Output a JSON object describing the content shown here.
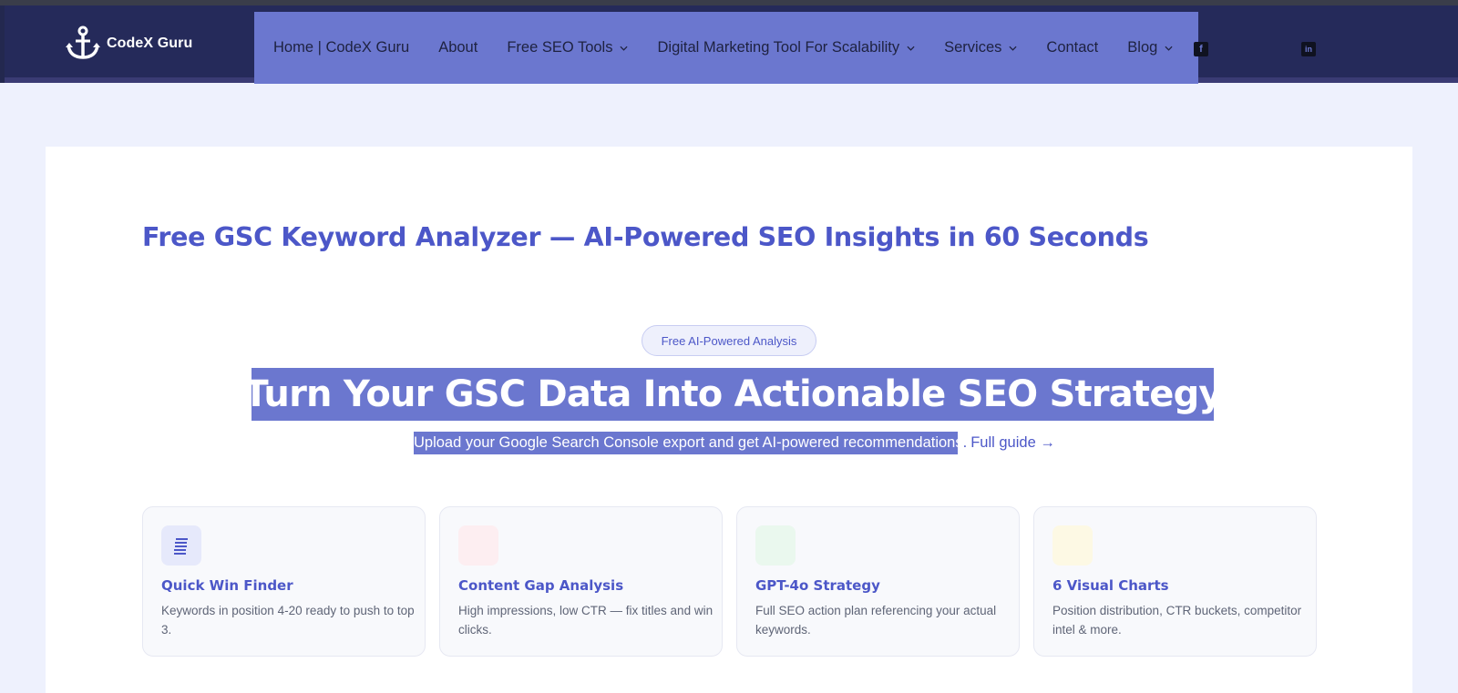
{
  "header": {
    "logo_text": "CodeX Guru",
    "nav": [
      {
        "label": "Home | CodeX Guru",
        "dropdown": false
      },
      {
        "label": "About",
        "dropdown": false
      },
      {
        "label": "Free SEO Tools",
        "dropdown": true
      },
      {
        "label": "Digital Marketing Tool For Scalability",
        "dropdown": true
      },
      {
        "label": "Services",
        "dropdown": true
      },
      {
        "label": "Contact",
        "dropdown": false
      },
      {
        "label": "Blog",
        "dropdown": true
      }
    ],
    "social": [
      {
        "icon": "facebook-icon",
        "glyph": "f"
      },
      {
        "icon": "linkedin-icon",
        "glyph": "in"
      }
    ]
  },
  "page": {
    "title": "Free GSC Keyword Analyzer — AI-Powered SEO Insights in 60 Seconds",
    "badge": "Free AI-Powered Analysis",
    "hero": "Turn Your GSC Data Into Actionable SEO Strategy",
    "subtitle": "Upload your Google Search Console export and get AI-powered recommendations",
    "subtitle_dot": ".",
    "guide_link": "Full guide →"
  },
  "features": [
    {
      "title": "Quick Win Finder",
      "desc": "Keywords in position 4-20 ready to push to top 3.",
      "icon": "document-icon",
      "icon_bg": "#e6e9fb"
    },
    {
      "title": "Content Gap Analysis",
      "desc": "High impressions, low CTR — fix titles and win clicks.",
      "icon": "gap-icon",
      "icon_bg": "#fdeef1"
    },
    {
      "title": "GPT-4o Strategy",
      "desc": "Full SEO action plan referencing your actual keywords.",
      "icon": "strategy-icon",
      "icon_bg": "#eaf8ee"
    },
    {
      "title": "6 Visual Charts",
      "desc": "Position distribution, CTR buckets, competitor intel & more.",
      "icon": "chart-icon",
      "icon_bg": "#fdf9e4"
    }
  ],
  "colors": {
    "accent": "#4c57c8",
    "nav_bg": "#6b77cf",
    "header_bg": "#252a5a",
    "page_bg": "#eef1fd"
  }
}
